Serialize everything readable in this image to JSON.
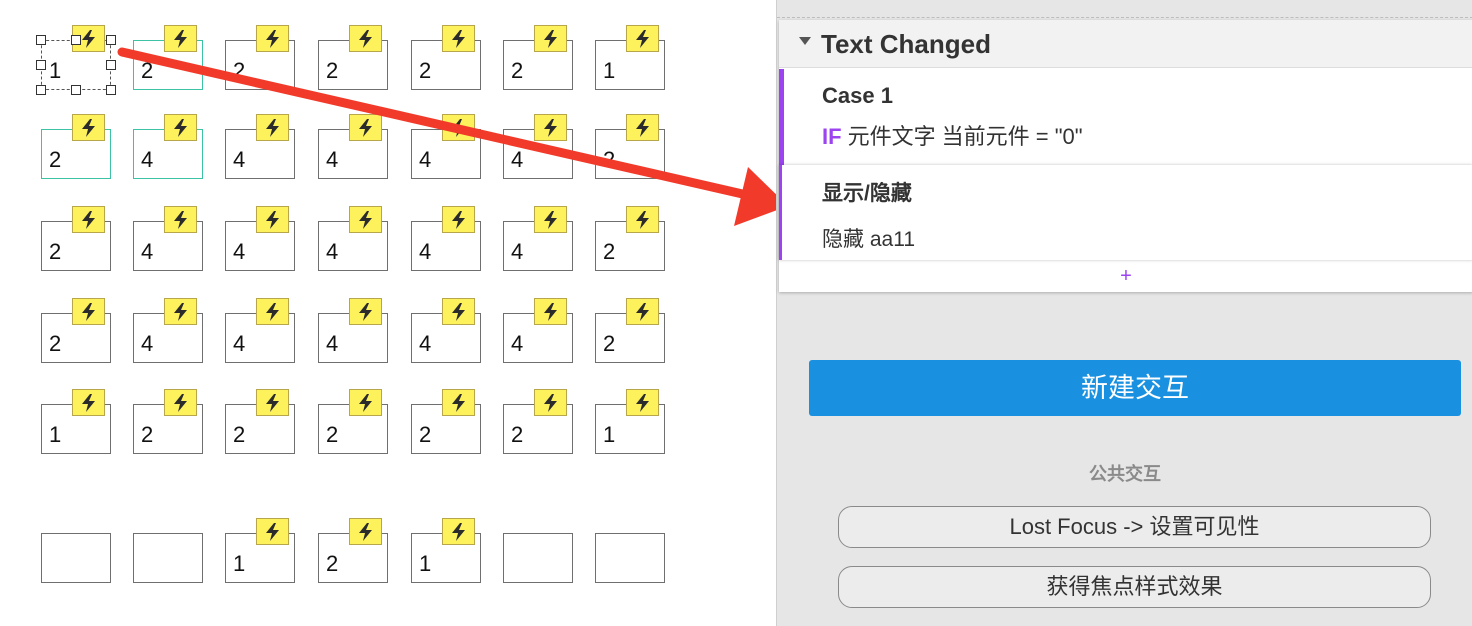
{
  "canvas": {
    "rows": [
      {
        "cells": [
          {
            "value": "1",
            "bolt": true,
            "style": "selected"
          },
          {
            "value": "2",
            "bolt": true,
            "style": "teal"
          },
          {
            "value": "2",
            "bolt": true,
            "style": "normal"
          },
          {
            "value": "2",
            "bolt": true,
            "style": "normal"
          },
          {
            "value": "2",
            "bolt": true,
            "style": "normal"
          },
          {
            "value": "2",
            "bolt": true,
            "style": "normal"
          },
          {
            "value": "1",
            "bolt": true,
            "style": "normal"
          }
        ]
      },
      {
        "cells": [
          {
            "value": "2",
            "bolt": true,
            "style": "teal"
          },
          {
            "value": "4",
            "bolt": true,
            "style": "teal"
          },
          {
            "value": "4",
            "bolt": true,
            "style": "normal"
          },
          {
            "value": "4",
            "bolt": true,
            "style": "normal"
          },
          {
            "value": "4",
            "bolt": true,
            "style": "normal"
          },
          {
            "value": "4",
            "bolt": true,
            "style": "normal"
          },
          {
            "value": "2",
            "bolt": true,
            "style": "normal"
          }
        ]
      },
      {
        "cells": [
          {
            "value": "2",
            "bolt": true,
            "style": "normal"
          },
          {
            "value": "4",
            "bolt": true,
            "style": "normal"
          },
          {
            "value": "4",
            "bolt": true,
            "style": "normal"
          },
          {
            "value": "4",
            "bolt": true,
            "style": "normal"
          },
          {
            "value": "4",
            "bolt": true,
            "style": "normal"
          },
          {
            "value": "4",
            "bolt": true,
            "style": "normal"
          },
          {
            "value": "2",
            "bolt": true,
            "style": "normal"
          }
        ]
      },
      {
        "cells": [
          {
            "value": "2",
            "bolt": true,
            "style": "normal"
          },
          {
            "value": "4",
            "bolt": true,
            "style": "normal"
          },
          {
            "value": "4",
            "bolt": true,
            "style": "normal"
          },
          {
            "value": "4",
            "bolt": true,
            "style": "normal"
          },
          {
            "value": "4",
            "bolt": true,
            "style": "normal"
          },
          {
            "value": "4",
            "bolt": true,
            "style": "normal"
          },
          {
            "value": "2",
            "bolt": true,
            "style": "normal"
          }
        ]
      },
      {
        "cells": [
          {
            "value": "1",
            "bolt": true,
            "style": "normal"
          },
          {
            "value": "2",
            "bolt": true,
            "style": "normal"
          },
          {
            "value": "2",
            "bolt": true,
            "style": "normal"
          },
          {
            "value": "2",
            "bolt": true,
            "style": "normal"
          },
          {
            "value": "2",
            "bolt": true,
            "style": "normal"
          },
          {
            "value": "2",
            "bolt": true,
            "style": "normal"
          },
          {
            "value": "1",
            "bolt": true,
            "style": "normal"
          }
        ]
      },
      {
        "cells": [
          {
            "value": "",
            "bolt": false,
            "style": "normal"
          },
          {
            "value": "",
            "bolt": false,
            "style": "normal"
          },
          {
            "value": "1",
            "bolt": true,
            "style": "normal"
          },
          {
            "value": "2",
            "bolt": true,
            "style": "normal"
          },
          {
            "value": "1",
            "bolt": true,
            "style": "normal"
          },
          {
            "value": "",
            "bolt": false,
            "style": "normal"
          },
          {
            "value": "",
            "bolt": false,
            "style": "normal"
          }
        ]
      }
    ],
    "bolt_icon": "lightning-icon",
    "annotation_arrow_color": "#f23a2a"
  },
  "panel": {
    "event": {
      "title": "Text Changed",
      "case": {
        "title": "Case 1",
        "condition_keyword": "IF",
        "condition": "元件文字 当前元件 = \"0\""
      },
      "action": {
        "title": "显示/隐藏",
        "detail": "隐藏 aa11"
      },
      "add_label": "+"
    },
    "new_interaction_label": "新建交互",
    "public_heading": "公共交互",
    "public_items": [
      {
        "label": "Lost Focus -> 设置可见性"
      },
      {
        "label": "获得焦点样式效果"
      }
    ],
    "accent_color": "#9b44f0",
    "button_color": "#1a91e0"
  }
}
